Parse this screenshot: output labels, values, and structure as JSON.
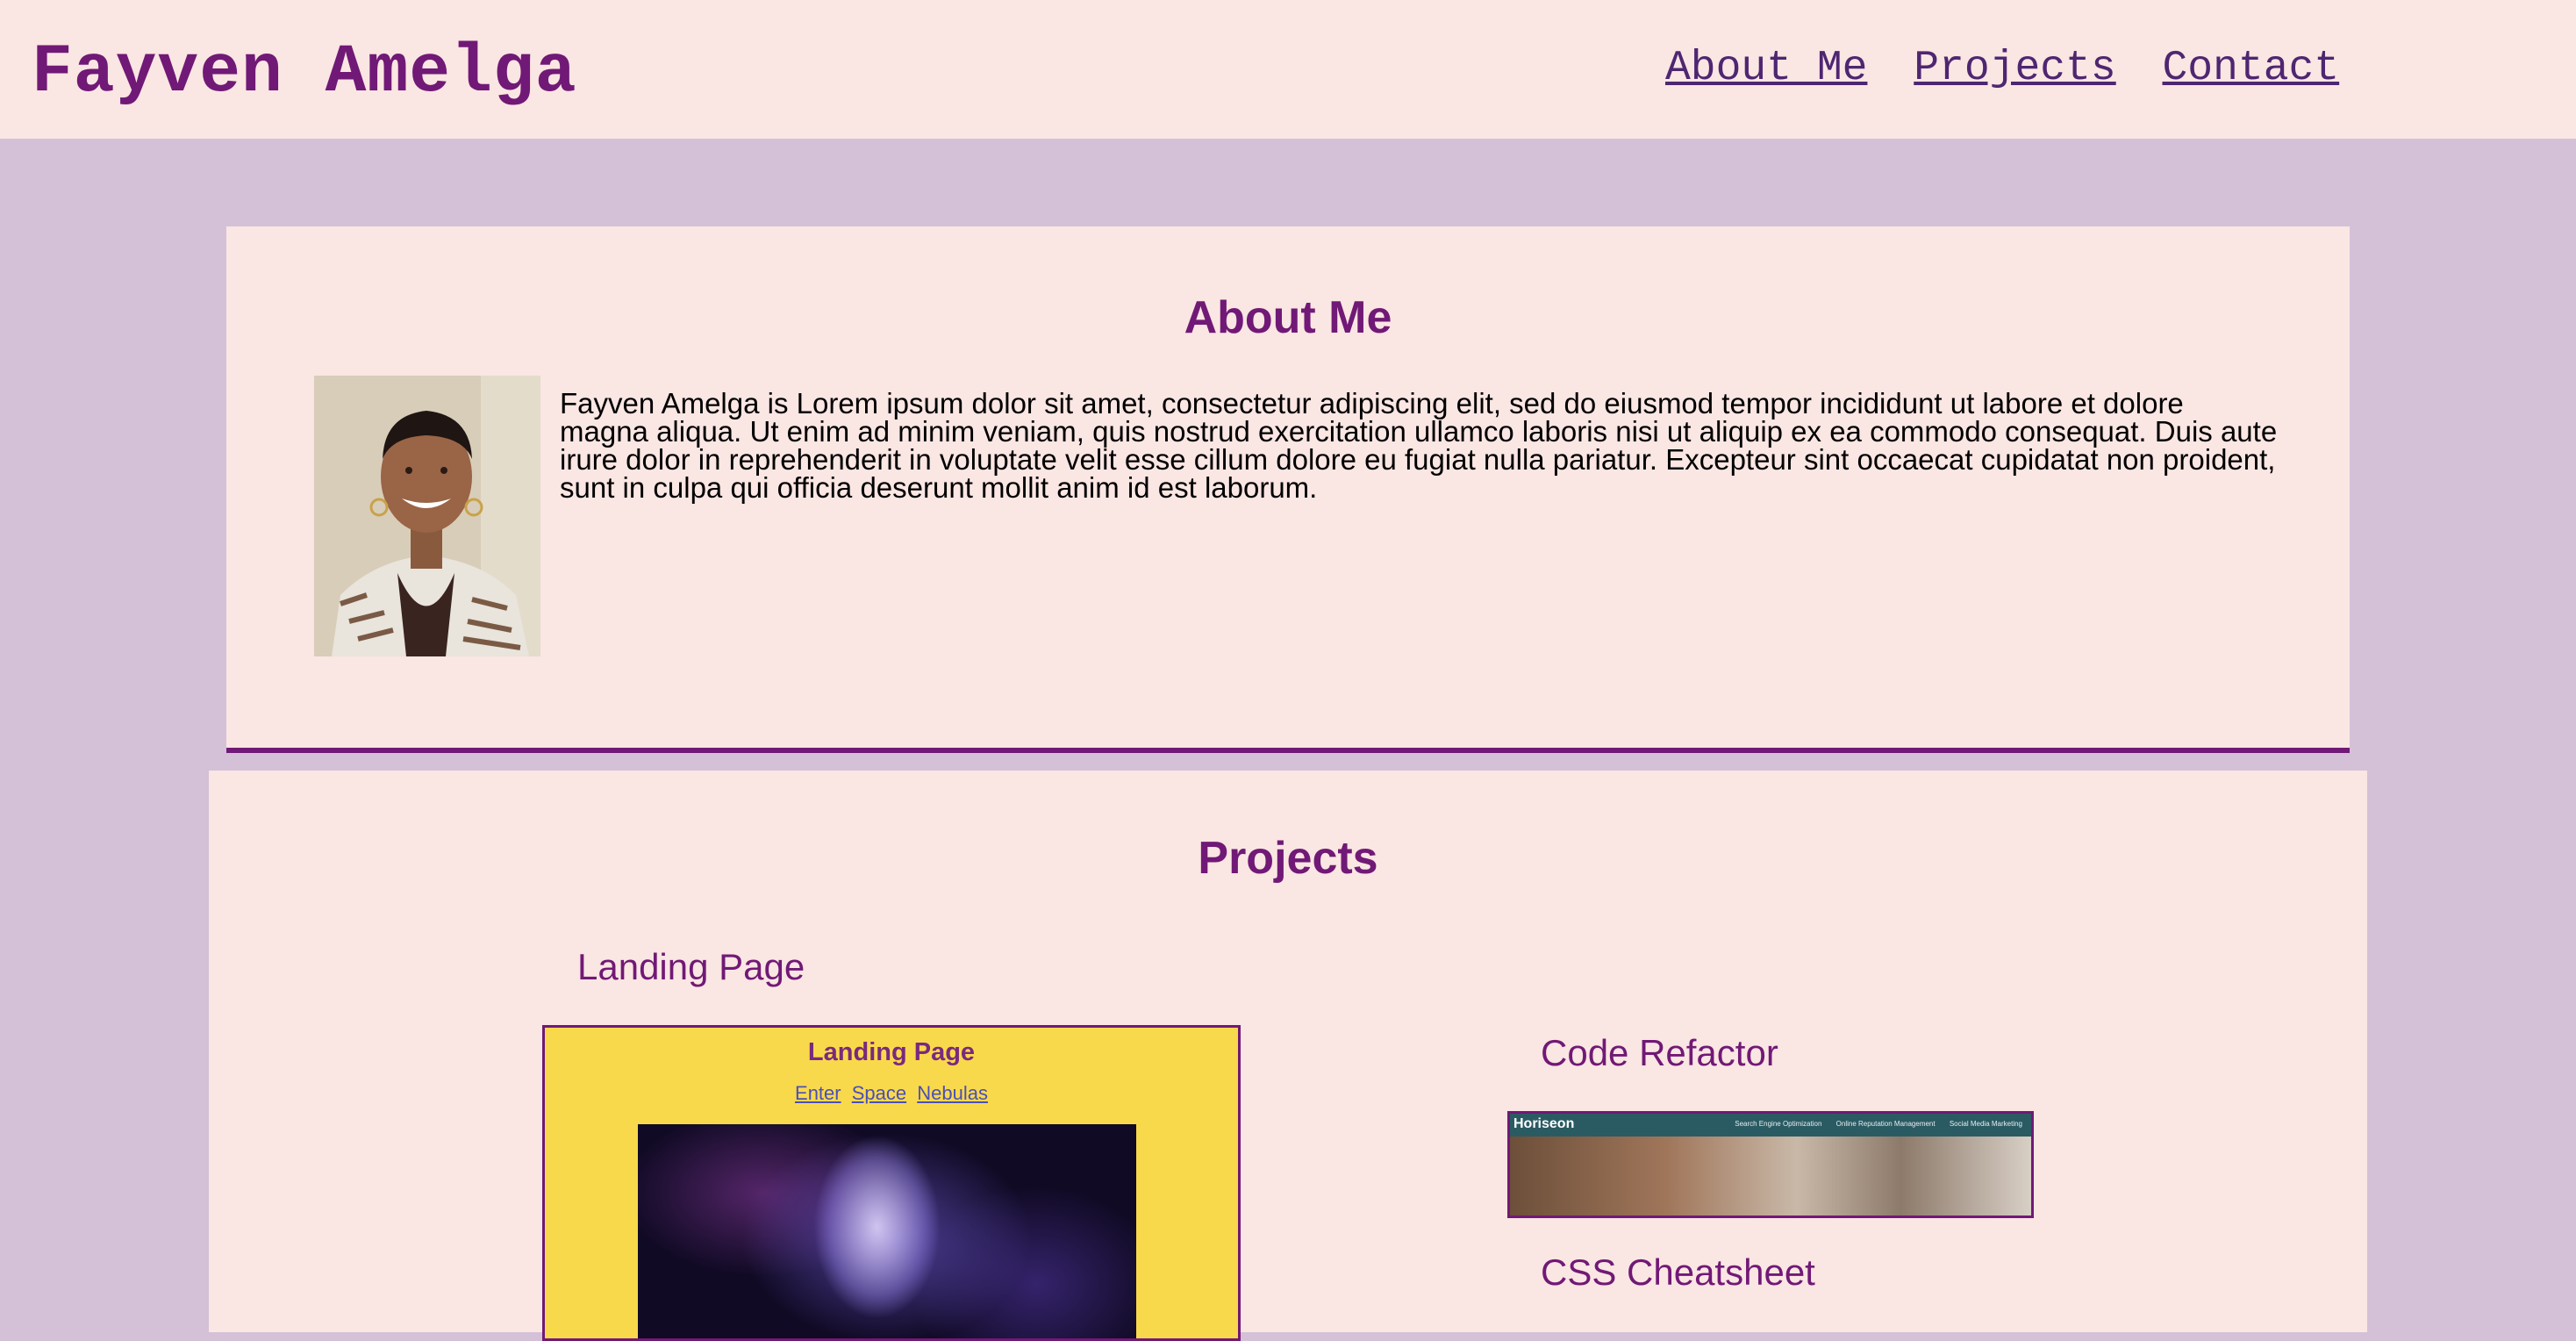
{
  "header": {
    "site_title": "Fayven Amelga",
    "nav": [
      "About Me",
      "Projects",
      "Contact"
    ]
  },
  "about": {
    "title": "About Me",
    "body": "Fayven Amelga is Lorem ipsum dolor sit amet, consectetur adipiscing elit, sed do eiusmod tempor incididunt ut labore et dolore magna aliqua. Ut enim ad minim veniam, quis nostrud exercitation ullamco laboris nisi ut aliquip ex ea commodo consequat. Duis aute irure dolor in reprehenderit in voluptate velit esse cillum dolore eu fugiat nulla pariatur. Excepteur sint occaecat cupidatat non proident, sunt in culpa qui officia deserunt mollit anim id est laborum."
  },
  "projects": {
    "title": "Projects",
    "landing": {
      "heading": "Landing Page",
      "card_title": "Landing Page",
      "card_links": [
        "Enter",
        "Space",
        "Nebulas"
      ]
    },
    "refactor": {
      "heading": "Code Refactor",
      "brand": "Horiseon",
      "nav": [
        "Search Engine Optimization",
        "Online Reputation Management",
        "Social Media Marketing"
      ]
    },
    "css": {
      "heading": "CSS Cheatsheet"
    }
  },
  "colors": {
    "page_bg": "#d4c0d7",
    "panel_bg": "#fae6e3",
    "accent": "#711976",
    "nav_link": "#4e2671",
    "landing_bg": "#f9d94c"
  }
}
